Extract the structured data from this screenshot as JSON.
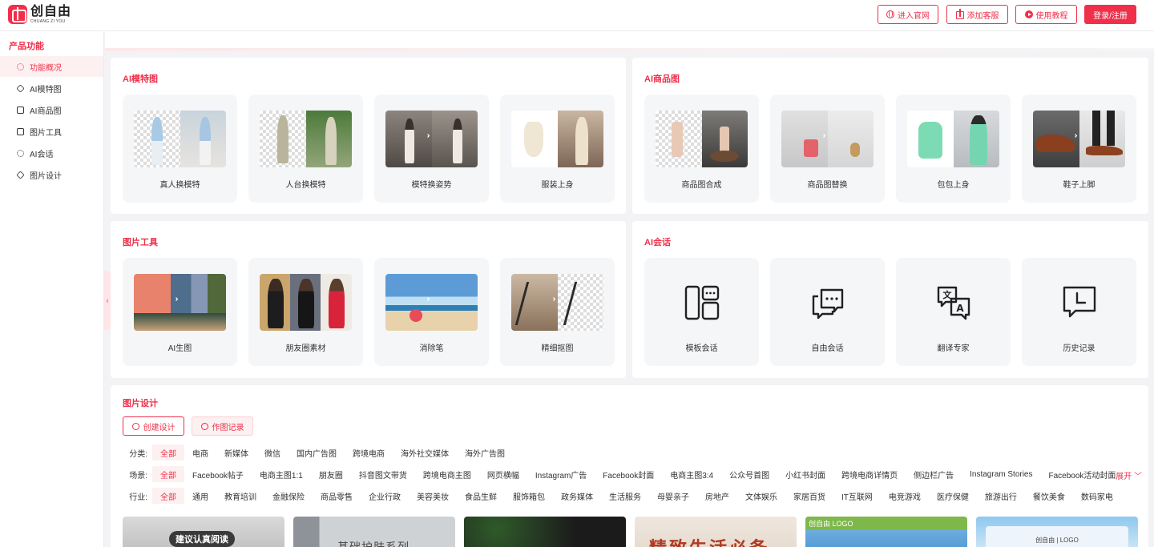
{
  "header": {
    "logo_cn": "创自由",
    "logo_en": "CHUANG ZI YOU",
    "btn_site": "进入官网",
    "btn_service": "添加客服",
    "btn_tutorial": "使用教程",
    "btn_login": "登录/注册"
  },
  "sidebar": {
    "title": "产品功能",
    "items": [
      {
        "label": "功能概况"
      },
      {
        "label": "AI模特图"
      },
      {
        "label": "AI商品图"
      },
      {
        "label": "图片工具"
      },
      {
        "label": "AI会话"
      },
      {
        "label": "图片设计"
      }
    ]
  },
  "model": {
    "title": "AI模特图",
    "tiles": [
      "真人换模特",
      "人台换模特",
      "模特换姿势",
      "服装上身"
    ]
  },
  "product": {
    "title": "AI商品图",
    "tiles": [
      "商品图合成",
      "商品图替换",
      "包包上身",
      "鞋子上脚"
    ]
  },
  "tools": {
    "title": "图片工具",
    "tiles": [
      "AI生图",
      "朋友圈素材",
      "消除笔",
      "精细抠图"
    ]
  },
  "chat": {
    "title": "AI会话",
    "tiles": [
      "模板会话",
      "自由会话",
      "翻译专家",
      "历史记录"
    ],
    "translate_glyph": "文",
    "translate_glyph2": "A"
  },
  "design": {
    "title": "图片设计",
    "btn_create": "创建设计",
    "btn_history": "作图记录",
    "expand": "展开",
    "category_label": "分类:",
    "categories": [
      "全部",
      "电商",
      "新媒体",
      "微信",
      "国内广告图",
      "跨境电商",
      "海外社交媒体",
      "海外广告图"
    ],
    "scene_label": "场景:",
    "scenes": [
      "全部",
      "Facebook帖子",
      "电商主图1:1",
      "朋友圈",
      "抖音图文带货",
      "跨境电商主图",
      "网页横幅",
      "Instagram广告",
      "Facebook封面",
      "电商主图3:4",
      "公众号首图",
      "小红书封面",
      "跨境电商详情页",
      "侧边栏广告",
      "Instagram Stories",
      "Facebook活动封面"
    ],
    "industry_label": "行业:",
    "industries": [
      "全部",
      "通用",
      "教育培训",
      "金融保险",
      "商品零售",
      "企业行政",
      "美容美妆",
      "食品生鲜",
      "服饰箱包",
      "政务媒体",
      "生活服务",
      "母婴亲子",
      "房地产",
      "文体娱乐",
      "家居百货",
      "IT互联网",
      "电竞游戏",
      "医疗保健",
      "旅游出行",
      "餐饮美食",
      "数码家电"
    ],
    "thumbs": [
      {
        "text": "建议认真阅读"
      },
      {
        "text": "基础护肤系列"
      },
      {
        "text": ""
      },
      {
        "text": "精致生活必备"
      },
      {
        "text": "创自由  LOGO"
      },
      {
        "text": "创自由 | LOGO"
      }
    ]
  },
  "colors": {
    "accent": "#f0304a",
    "accent_soft": "#fdf0f1"
  }
}
